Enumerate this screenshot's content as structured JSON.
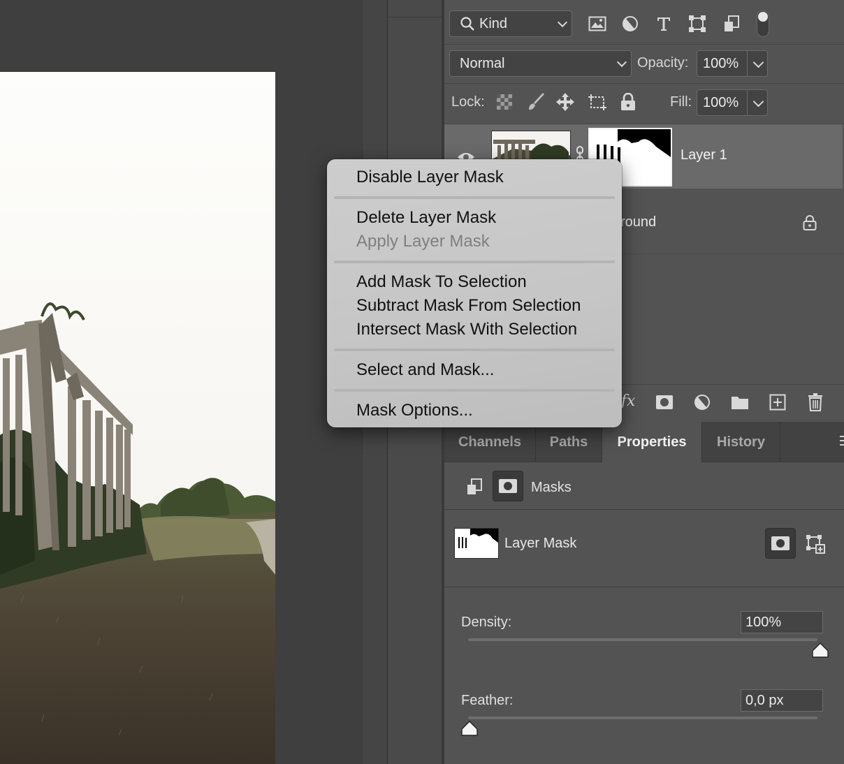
{
  "layers_panel": {
    "filter": {
      "kind_label": "Kind"
    },
    "blend": {
      "mode": "Normal",
      "opacity_label": "Opacity:",
      "opacity_value": "100%"
    },
    "lock": {
      "label": "Lock:",
      "fill_label": "Fill:",
      "fill_value": "100%"
    },
    "layers": [
      {
        "name": "Layer 1",
        "visible": true,
        "selected": true,
        "has_mask": true
      },
      {
        "name": "Background",
        "visible_text": "round",
        "locked": true
      }
    ],
    "footer_icons": [
      "fx-icon",
      "add-mask-icon",
      "adjustment-icon",
      "folder-icon",
      "new-layer-icon",
      "trash-icon"
    ]
  },
  "context_menu": {
    "groups": [
      [
        {
          "label": "Disable Layer Mask",
          "enabled": true
        }
      ],
      [
        {
          "label": "Delete Layer Mask",
          "enabled": true
        },
        {
          "label": "Apply Layer Mask",
          "enabled": false
        }
      ],
      [
        {
          "label": "Add Mask To Selection",
          "enabled": true
        },
        {
          "label": "Subtract Mask From Selection",
          "enabled": true
        },
        {
          "label": "Intersect Mask With Selection",
          "enabled": true
        }
      ],
      [
        {
          "label": "Select and Mask...",
          "enabled": true
        }
      ],
      [
        {
          "label": "Mask Options...",
          "enabled": true
        }
      ]
    ]
  },
  "bottom_panel": {
    "tabs": [
      {
        "label": "Channels",
        "active": false
      },
      {
        "label": "Paths",
        "active": false
      },
      {
        "label": "Properties",
        "active": true
      },
      {
        "label": "History",
        "active": false
      }
    ],
    "properties": {
      "section_label": "Masks",
      "mask_name": "Layer Mask",
      "density_label": "Density:",
      "density_value": "100%",
      "density_level": 1.0,
      "feather_label": "Feather:",
      "feather_value": "0,0 px",
      "feather_level": 0.0
    }
  }
}
